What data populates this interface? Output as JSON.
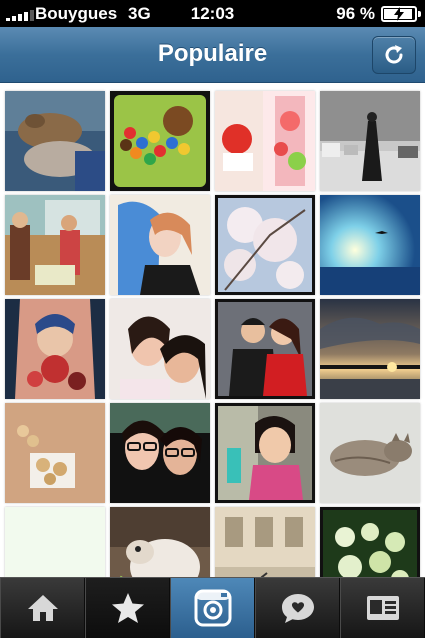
{
  "status_bar": {
    "carrier": "Bouygues",
    "network": "3G",
    "time": "12:03",
    "battery": "96 %"
  },
  "nav": {
    "title": "Populaire",
    "refresh_icon": "refresh-icon"
  },
  "photos": [
    {
      "name": "photo-rabbits"
    },
    {
      "name": "photo-candies"
    },
    {
      "name": "photo-apple-flowers"
    },
    {
      "name": "photo-street-woman"
    },
    {
      "name": "photo-people-window"
    },
    {
      "name": "photo-blue-hair-girl"
    },
    {
      "name": "photo-cherry-blossom"
    },
    {
      "name": "photo-sea-bird"
    },
    {
      "name": "photo-tattoo"
    },
    {
      "name": "photo-two-women-selfie"
    },
    {
      "name": "photo-couple"
    },
    {
      "name": "photo-sunset-pier"
    },
    {
      "name": "photo-cookies"
    },
    {
      "name": "photo-glasses-women"
    },
    {
      "name": "photo-child"
    },
    {
      "name": "photo-sleeping-cat"
    },
    {
      "name": "photo-pale"
    },
    {
      "name": "photo-dog"
    },
    {
      "name": "photo-building-bike"
    },
    {
      "name": "photo-green-flowers"
    }
  ],
  "tab_bar": {
    "tabs": [
      {
        "icon": "home-icon"
      },
      {
        "icon": "star-icon"
      },
      {
        "icon": "camera-icon"
      },
      {
        "icon": "speech-bubble-icon"
      },
      {
        "icon": "profile-card-icon"
      }
    ]
  },
  "colors": {
    "nav_blue": "#3b6f9a",
    "camera_tab_blue": "#3d75a6"
  }
}
